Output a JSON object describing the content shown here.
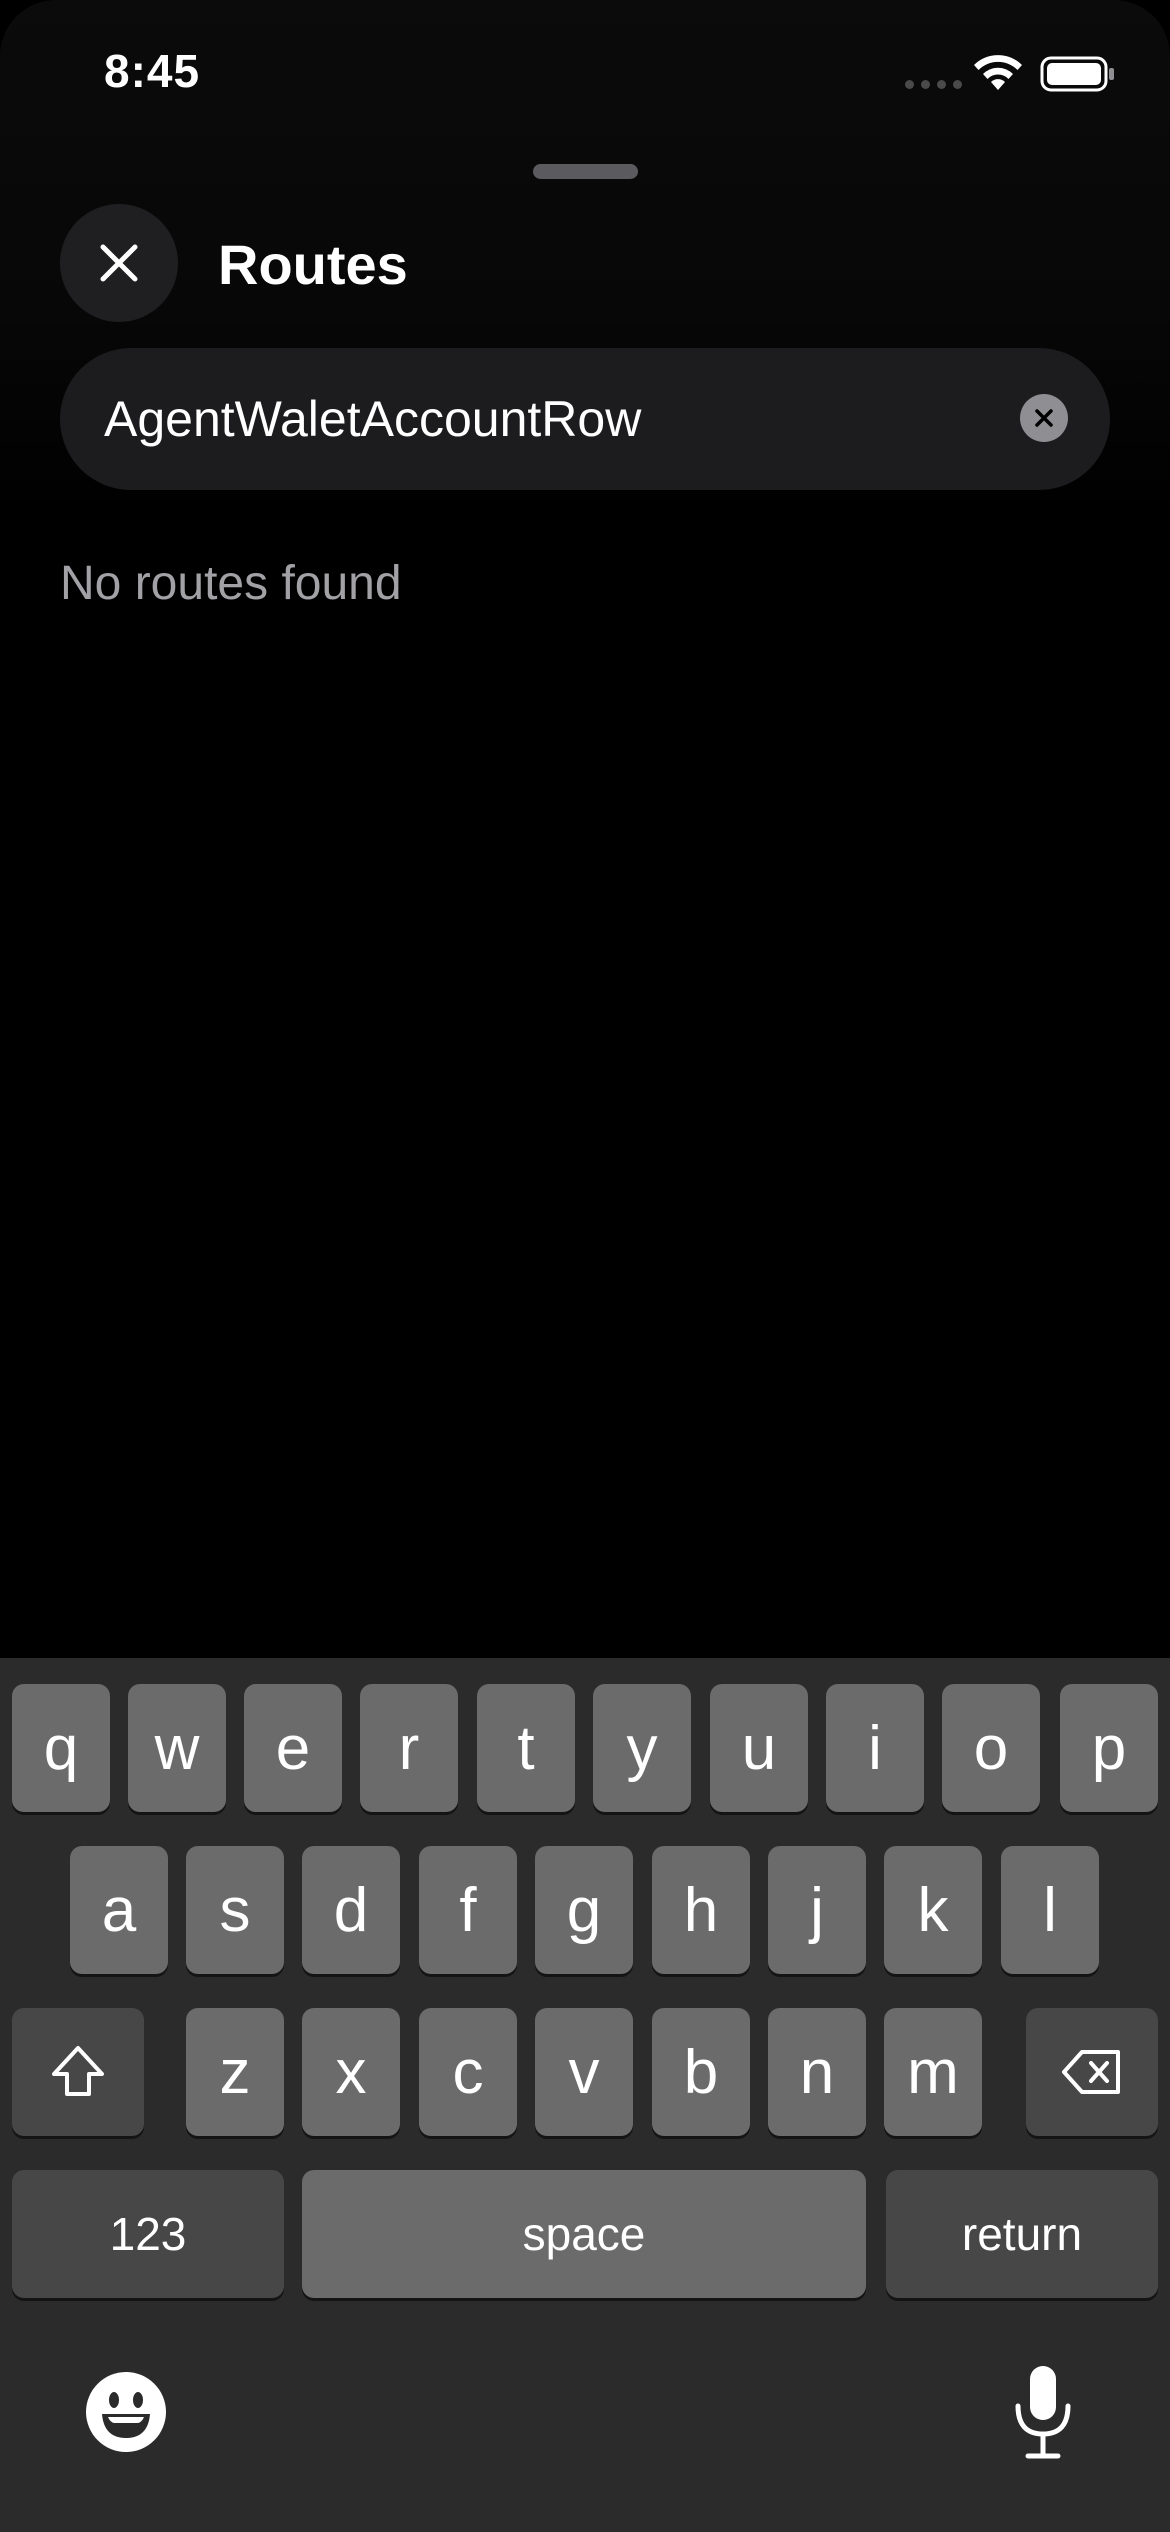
{
  "status_bar": {
    "time": "8:45"
  },
  "header": {
    "title": "Routes",
    "close_icon": "close-icon"
  },
  "search": {
    "value": "AgentWaletAccountRow",
    "clear_icon": "clear-icon"
  },
  "results": {
    "empty_message": "No routes found"
  },
  "keyboard": {
    "row1": [
      "q",
      "w",
      "e",
      "r",
      "t",
      "y",
      "u",
      "i",
      "o",
      "p"
    ],
    "row2": [
      "a",
      "s",
      "d",
      "f",
      "g",
      "h",
      "j",
      "k",
      "l"
    ],
    "row3": [
      "z",
      "x",
      "c",
      "v",
      "b",
      "n",
      "m"
    ],
    "numbers_label": "123",
    "space_label": "space",
    "return_label": "return",
    "shift_icon": "shift-icon",
    "delete_icon": "delete-icon",
    "emoji_icon": "emoji-icon",
    "mic_icon": "microphone-icon"
  },
  "colors": {
    "background": "#000000",
    "field": "#1c1c1e",
    "keyboard": "#2b2b2b",
    "key": "#6b6b6b",
    "key_dark": "#474747",
    "secondary_text": "#a1a1a6"
  }
}
